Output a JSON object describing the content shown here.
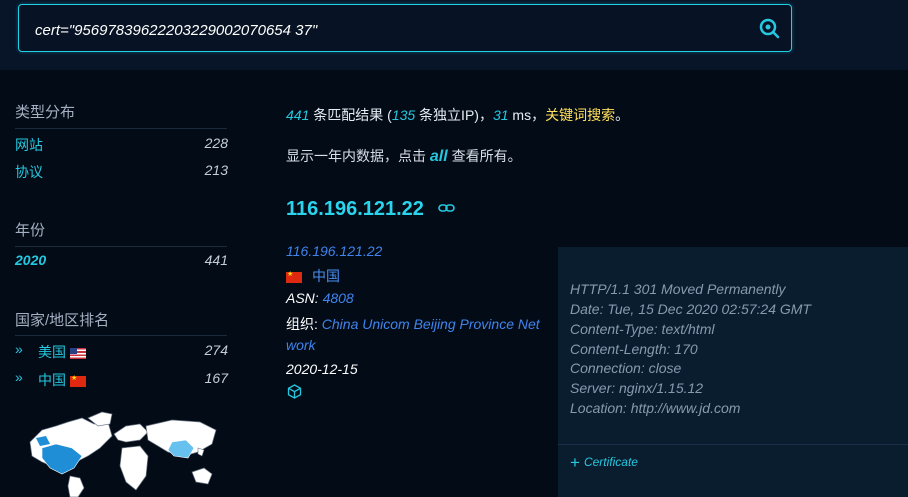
{
  "search": {
    "query": "cert=\"95697839622203229002070654 37\""
  },
  "sidebar": {
    "type_section": {
      "title": "类型分布",
      "items": [
        {
          "label": "网站",
          "count": "228"
        },
        {
          "label": "协议",
          "count": "213"
        }
      ]
    },
    "year_section": {
      "title": "年份",
      "items": [
        {
          "label": "2020",
          "count": "441"
        }
      ]
    },
    "country_section": {
      "title": "国家/地区排名",
      "items": [
        {
          "label": "美国",
          "count": "274",
          "flag": "us-flag"
        },
        {
          "label": "中国",
          "count": "167",
          "flag": "cn-flag"
        }
      ]
    }
  },
  "summary": {
    "total": "441",
    "text1": " 条匹配结果 (",
    "unique": "135",
    "text2": " 条独立IP)，",
    "ms": "31",
    "text3": " ms，",
    "keyword_link": "关键词搜索",
    "text4": "。"
  },
  "notice": {
    "text1": "显示一年内数据，点击 ",
    "all_link": "all",
    "text2": " 查看所有。"
  },
  "result": {
    "ip_title": "116.196.121.22",
    "ip": "116.196.121.22",
    "country": "中国",
    "asn_label": "ASN: ",
    "asn": "4808",
    "org_label": "组织: ",
    "org_line1": "China Unicom Beijing Province Net",
    "org_line2": "work",
    "date": "2020-12-15",
    "headers": [
      "HTTP/1.1 301 Moved Permanently",
      "Date: Tue, 15 Dec 2020 02:57:24 GMT",
      "Content-Type: text/html",
      "Content-Length: 170",
      "Connection: close",
      "Server: nginx/1.15.12",
      "Location: http://www.jd.com"
    ],
    "cert_toggle": "Certificate"
  },
  "colors": {
    "accent": "#25c8df",
    "link": "#3f84ec",
    "highlight": "#ffe05a",
    "background": "#030b17"
  }
}
